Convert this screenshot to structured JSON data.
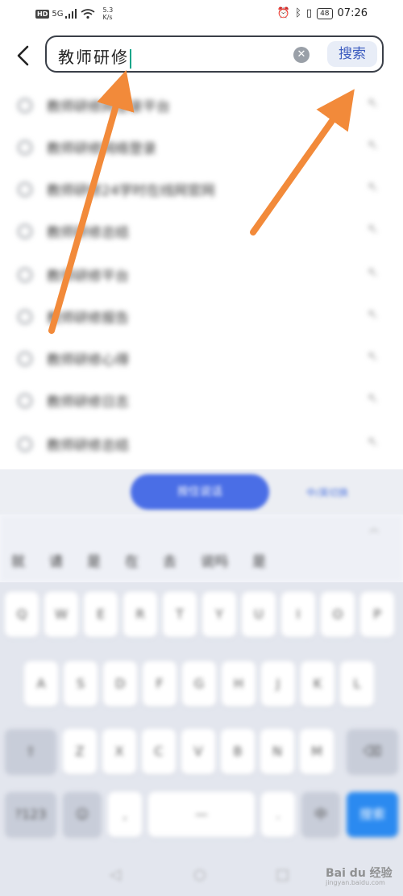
{
  "status_bar": {
    "hd": "HD",
    "signal": "5G",
    "speed_value": "5.3",
    "speed_unit": "K/s",
    "battery": "48",
    "time": "07:26"
  },
  "search": {
    "query": "教师研修",
    "clear_icon": "clear-icon",
    "button_label": "搜索"
  },
  "suggestions": [
    "教师研修网登录平台",
    "教师研修网络登录",
    "教师研修24学时在线网官网",
    "教师研修总结",
    "教师研修平台",
    "教师研修报告",
    "教师研修心得",
    "教师研修日志",
    "教师研修总结"
  ],
  "keyboard": {
    "voice_label": "按住说话",
    "side_label": "中/英切换",
    "candidates": [
      "就",
      "请",
      "是",
      "在",
      "去",
      "说吗",
      "是"
    ],
    "row1": [
      "Q",
      "W",
      "E",
      "R",
      "T",
      "Y",
      "U",
      "I",
      "O",
      "P"
    ],
    "row2": [
      "A",
      "S",
      "D",
      "F",
      "G",
      "H",
      "J",
      "K",
      "L"
    ],
    "row3": [
      "Z",
      "X",
      "C",
      "V",
      "B",
      "N",
      "M"
    ],
    "enter_label": "搜索"
  },
  "watermark": {
    "brand": "Bai du 经验",
    "url": "jingyan.baidu.com"
  },
  "colors": {
    "accent": "#4a6ee6",
    "annotation_arrow": "#f28a3a",
    "caret": "#16a68a"
  }
}
